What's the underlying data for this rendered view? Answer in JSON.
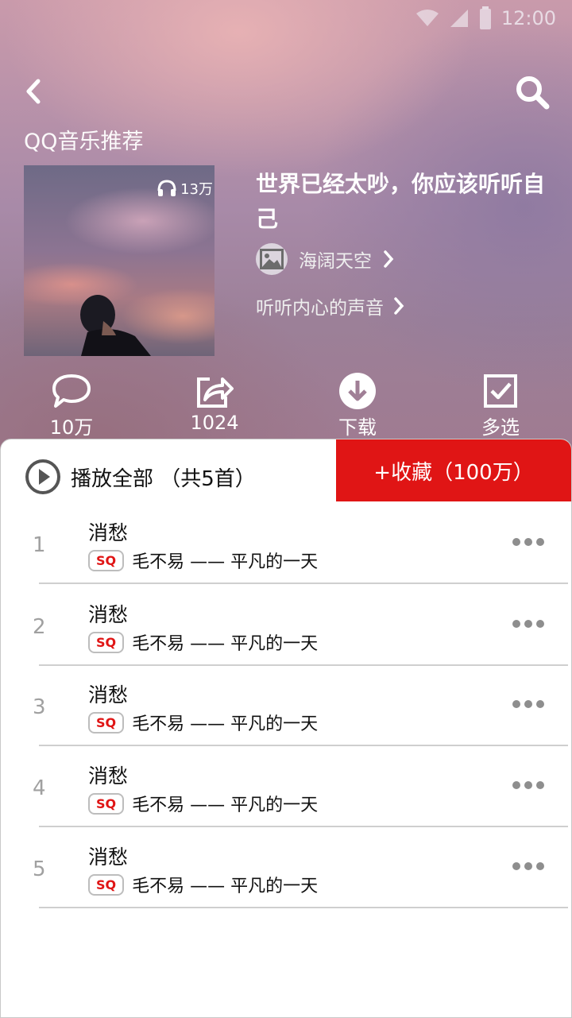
{
  "status": {
    "time": "12:00"
  },
  "header": {
    "section_title": "QQ音乐推荐"
  },
  "album": {
    "title": "世界已经太吵，你应该听听自己",
    "play_count": "13万",
    "author": "海阔天空",
    "description": "听听内心的声音"
  },
  "actions": [
    {
      "label": "10万",
      "icon": "comment-icon"
    },
    {
      "label": "1024",
      "icon": "share-icon"
    },
    {
      "label": "下载",
      "icon": "download-icon"
    },
    {
      "label": "多选",
      "icon": "multi-select-icon"
    }
  ],
  "playlist": {
    "play_all_label": "播放全部 （共5首）",
    "collect_label": "+收藏（100万）",
    "songs": [
      {
        "index": "1",
        "name": "消愁",
        "quality": "SQ",
        "detail": "毛不易 —— 平凡的一天"
      },
      {
        "index": "2",
        "name": "消愁",
        "quality": "SQ",
        "detail": "毛不易 —— 平凡的一天"
      },
      {
        "index": "3",
        "name": "消愁",
        "quality": "SQ",
        "detail": "毛不易 —— 平凡的一天"
      },
      {
        "index": "4",
        "name": "消愁",
        "quality": "SQ",
        "detail": "毛不易 —— 平凡的一天"
      },
      {
        "index": "5",
        "name": "消愁",
        "quality": "SQ",
        "detail": "毛不易 —— 平凡的一天"
      }
    ]
  },
  "colors": {
    "accent": "#e01515"
  }
}
